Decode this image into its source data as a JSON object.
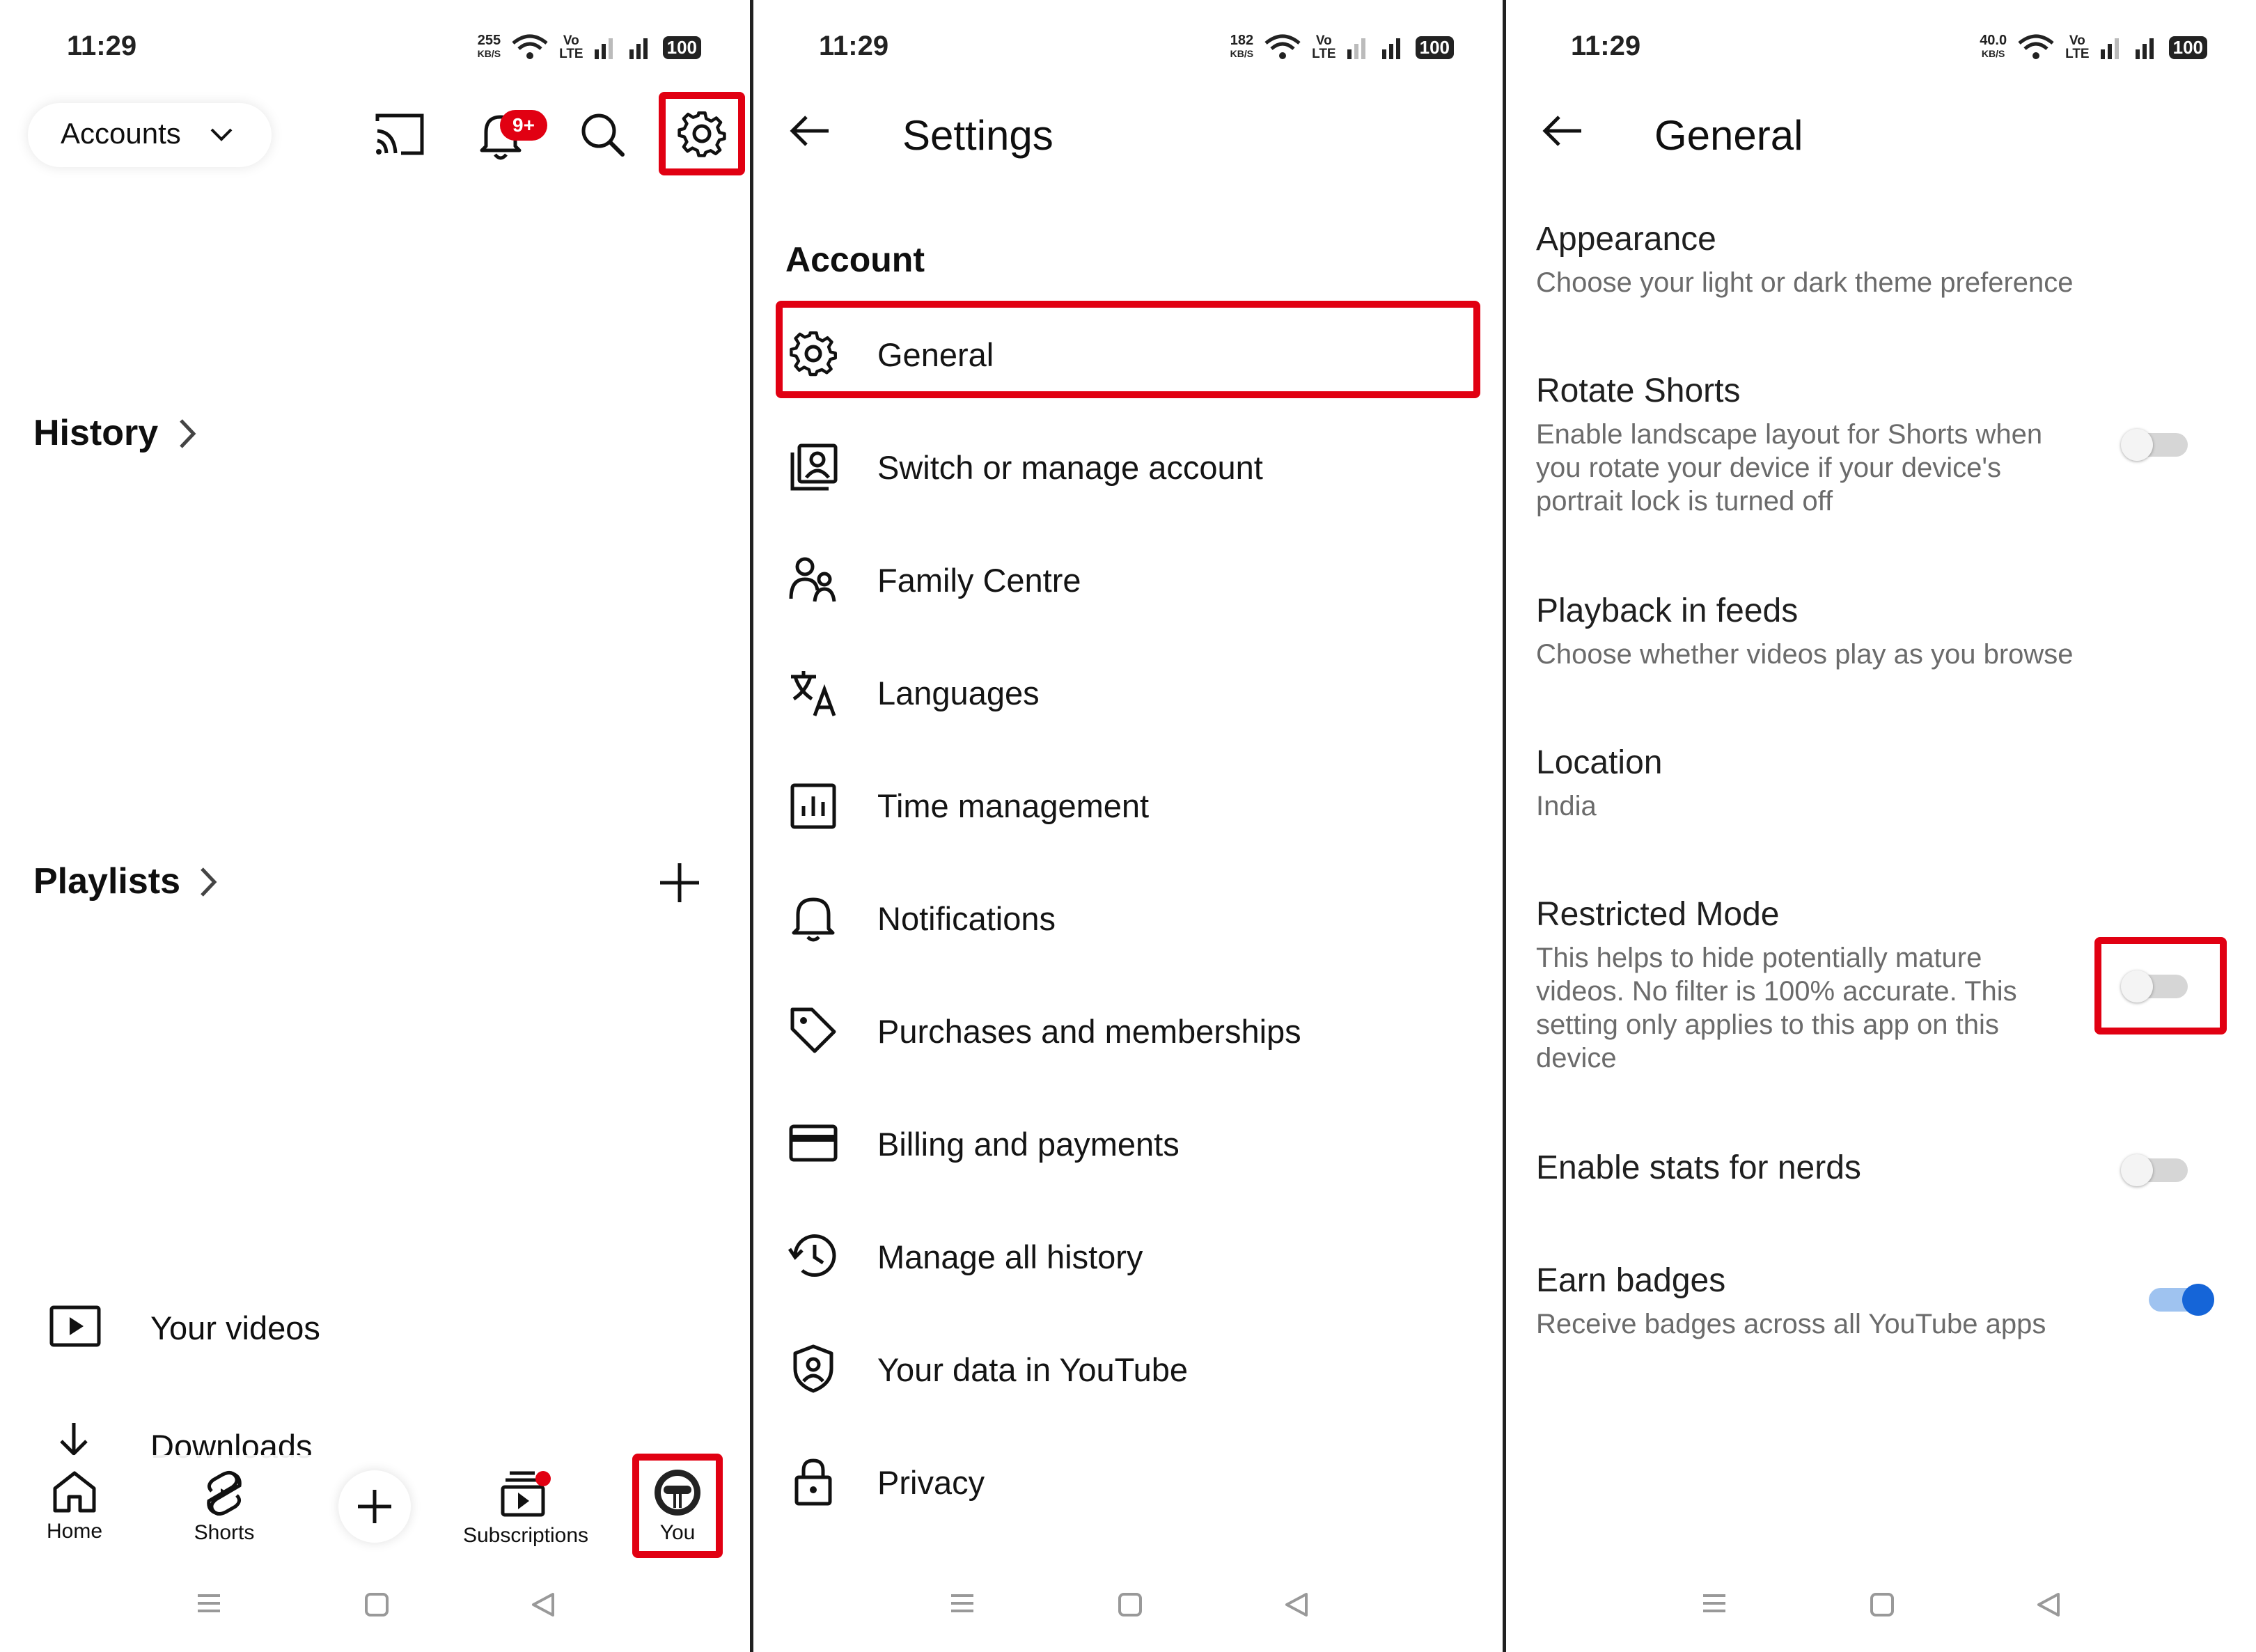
{
  "panels": {
    "you": {
      "status": {
        "time": "11:29",
        "net_speed": "255",
        "net_unit": "KB/S",
        "volte": "Vo",
        "lte": "LTE",
        "battery": "100"
      },
      "header": {
        "accounts_label": "Accounts",
        "notification_badge": "9+"
      },
      "sections": {
        "history": "History",
        "playlists": "Playlists"
      },
      "items": {
        "your_videos": "Your videos",
        "downloads": "Downloads"
      },
      "bottom_nav": {
        "home": "Home",
        "shorts": "Shorts",
        "subscriptions": "Subscriptions",
        "you": "You"
      }
    },
    "settings": {
      "status": {
        "time": "11:29",
        "net_speed": "182",
        "net_unit": "KB/S",
        "volte": "Vo",
        "lte": "LTE",
        "battery": "100"
      },
      "title": "Settings",
      "section": "Account",
      "items": [
        {
          "label": "General",
          "icon": "gear-icon"
        },
        {
          "label": "Switch or manage account",
          "icon": "account-switch-icon"
        },
        {
          "label": "Family Centre",
          "icon": "family-icon"
        },
        {
          "label": "Languages",
          "icon": "translate-icon"
        },
        {
          "label": "Time management",
          "icon": "chart-icon"
        },
        {
          "label": "Notifications",
          "icon": "bell-icon"
        },
        {
          "label": "Purchases and memberships",
          "icon": "tag-icon"
        },
        {
          "label": "Billing and payments",
          "icon": "card-icon"
        },
        {
          "label": "Manage all history",
          "icon": "history-icon"
        },
        {
          "label": "Your data in YouTube",
          "icon": "shield-person-icon"
        },
        {
          "label": "Privacy",
          "icon": "lock-icon"
        }
      ]
    },
    "general": {
      "status": {
        "time": "11:29",
        "net_speed": "40.0",
        "net_unit": "KB/S",
        "volte": "Vo",
        "lte": "LTE",
        "battery": "100"
      },
      "title": "General",
      "settings": [
        {
          "title": "Appearance",
          "subtitle": "Choose your light or dark theme preference"
        },
        {
          "title": "Rotate Shorts",
          "subtitle_lines": [
            "Enable landscape layout for Shorts when",
            "you rotate your device if your device's",
            "portrait lock is turned off"
          ],
          "toggle": false
        },
        {
          "title": "Playback in feeds",
          "subtitle": "Choose whether videos play as you browse"
        },
        {
          "title": "Location",
          "subtitle": "India"
        },
        {
          "title": "Restricted Mode",
          "subtitle_lines": [
            "This helps to hide potentially mature",
            "videos. No filter is 100% accurate. This",
            "setting only applies to this app on this",
            "device"
          ],
          "toggle": false
        },
        {
          "title": "Enable stats for nerds",
          "toggle": false
        },
        {
          "title": "Earn badges",
          "subtitle": "Receive badges across all YouTube apps",
          "toggle": true
        }
      ]
    }
  },
  "colors": {
    "highlight": "#e10012",
    "toggle_on": "#1565d8",
    "badge": "#e10012"
  }
}
